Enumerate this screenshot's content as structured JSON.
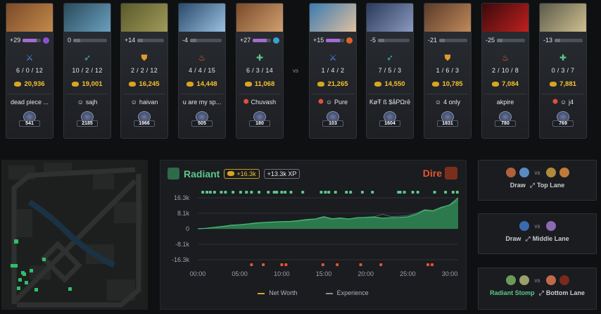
{
  "players": [
    {
      "team": "radiant",
      "net_change": "+29",
      "level_fill": 0.75,
      "facet_color": "#8b4fd0",
      "role_icon": "sword-icon",
      "role_color": "#5a8bf0",
      "kda": "6 / 0 / 12",
      "net_worth": "20,936",
      "name": "dead piece ...",
      "status": "",
      "medal": "541",
      "portrait_colors": [
        "#7a4a2a",
        "#c48a4a"
      ]
    },
    {
      "team": "radiant",
      "net_change": "0",
      "level_fill": 0.0,
      "facet_color": "",
      "role_icon": "bow-icon",
      "role_color": "#38b7b0",
      "kda": "10 / 2 / 12",
      "net_worth": "19,001",
      "name": "sajh",
      "status": "smile",
      "medal": "2185",
      "portrait_colors": [
        "#2a4a5a",
        "#6aa0c0"
      ]
    },
    {
      "team": "radiant",
      "net_change": "+14",
      "level_fill": 0.0,
      "facet_color": "",
      "role_icon": "shield-icon",
      "role_color": "#e09a2a",
      "kda": "2 / 2 / 12",
      "net_worth": "16,245",
      "name": "haivan",
      "status": "smile",
      "medal": "1966",
      "portrait_colors": [
        "#5a5a2a",
        "#a09a5a"
      ]
    },
    {
      "team": "radiant",
      "net_change": "-4",
      "level_fill": 0.0,
      "facet_color": "",
      "role_icon": "fire-icon",
      "role_color": "#e06a3a",
      "kda": "4 / 4 / 15",
      "net_worth": "14,448",
      "name": "u are my sp...",
      "status": "",
      "medal": "505",
      "portrait_colors": [
        "#2a4a6a",
        "#9ac0e0"
      ]
    },
    {
      "team": "radiant",
      "net_change": "+27",
      "level_fill": 0.75,
      "facet_color": "#3aa0d0",
      "role_icon": "support-icon",
      "role_color": "#5cc88b",
      "kda": "6 / 3 / 14",
      "net_worth": "11,068",
      "name": "Chuvash",
      "status": "shield",
      "medal": "180",
      "portrait_colors": [
        "#7a4a2a",
        "#d0a070"
      ]
    },
    {
      "team": "dire",
      "net_change": "+15",
      "level_fill": 0.75,
      "facet_color": "#e0602a",
      "role_icon": "sword-icon",
      "role_color": "#5a8bf0",
      "kda": "1 / 4 / 2",
      "net_worth": "21,265",
      "name": "Pure",
      "status": "shield-smile",
      "medal": "103",
      "portrait_colors": [
        "#3a7ab0",
        "#e0c0a0"
      ]
    },
    {
      "team": "dire",
      "net_change": "-5",
      "level_fill": 0.0,
      "facet_color": "",
      "role_icon": "bow-icon",
      "role_color": "#38b7b0",
      "kda": "7 / 5 / 3",
      "net_worth": "14,550",
      "name": "ƘøŦ ß $åPΩrē",
      "status": "",
      "medal": "1604",
      "portrait_colors": [
        "#2a3a5a",
        "#8a9ac0"
      ]
    },
    {
      "team": "dire",
      "net_change": "-21",
      "level_fill": 0.0,
      "facet_color": "",
      "role_icon": "shield-icon",
      "role_color": "#e09a2a",
      "kda": "1 / 6 / 3",
      "net_worth": "10,785",
      "name": "4 only",
      "status": "smile",
      "medal": "1831",
      "portrait_colors": [
        "#5a3a2a",
        "#c08a5a"
      ]
    },
    {
      "team": "dire",
      "net_change": "-25",
      "level_fill": 0.0,
      "facet_color": "",
      "role_icon": "fire-icon",
      "role_color": "#e06a3a",
      "kda": "2 / 10 / 8",
      "net_worth": "7,084",
      "name": "akpire",
      "status": "",
      "medal": "780",
      "portrait_colors": [
        "#3a0a0a",
        "#c02020"
      ]
    },
    {
      "team": "dire",
      "net_change": "-13",
      "level_fill": 0.0,
      "facet_color": "",
      "role_icon": "support-icon",
      "role_color": "#5cc88b",
      "kda": "0 / 3 / 7",
      "net_worth": "7,881",
      "name": "j4",
      "status": "shield-smile",
      "medal": "769",
      "portrait_colors": [
        "#5a5a4a",
        "#d0c090"
      ]
    }
  ],
  "vs_label": "vs",
  "graph": {
    "radiant_label": "Radiant",
    "dire_label": "Dire",
    "gold_adv": "+16.3k",
    "xp_adv": "+13.3k XP",
    "legend_networth": "Net Worth",
    "legend_experience": "Experience",
    "colors": {
      "radiant": "#5cc88b",
      "dire": "#e8532f",
      "area": "#2f8a55"
    }
  },
  "chart_data": {
    "type": "area",
    "x_ticks": [
      "00:00",
      "05:00",
      "10:00",
      "15:00",
      "20:00",
      "25:00",
      "30:00"
    ],
    "y_ticks": [
      "16.3k",
      "8.1k",
      "0",
      "-8.1k",
      "-16.3k"
    ],
    "ylim": [
      -16300,
      16300
    ],
    "xlim": [
      0,
      31
    ],
    "series": [
      {
        "name": "Net Worth",
        "x": [
          0,
          1,
          2,
          3,
          4,
          5,
          6,
          7,
          8,
          9,
          10,
          11,
          12,
          13,
          14,
          15,
          16,
          17,
          18,
          19,
          20,
          21,
          22,
          23,
          24,
          25,
          26,
          27,
          28,
          29,
          30,
          31
        ],
        "values": [
          0,
          300,
          800,
          1300,
          1900,
          2200,
          2600,
          3100,
          3400,
          3600,
          3800,
          3900,
          4300,
          4900,
          5200,
          6400,
          5300,
          5700,
          5100,
          5900,
          6000,
          6200,
          5600,
          5900,
          6000,
          6300,
          7600,
          9800,
          9300,
          11200,
          12600,
          16300
        ]
      },
      {
        "name": "Experience",
        "x": [
          0,
          1,
          2,
          3,
          4,
          5,
          6,
          7,
          8,
          9,
          10,
          11,
          12,
          13,
          14,
          15,
          16,
          17,
          18,
          19,
          20,
          21,
          22,
          23,
          24,
          25,
          26,
          27,
          28,
          29,
          30,
          31
        ],
        "values": [
          0,
          200,
          700,
          1200,
          1700,
          2100,
          2500,
          2900,
          3300,
          3500,
          3700,
          3800,
          4100,
          4600,
          5000,
          6100,
          5100,
          5500,
          5300,
          5800,
          6100,
          6400,
          7700,
          6500,
          6600,
          7000,
          8200,
          10100,
          9800,
          11500,
          12400,
          14800
        ]
      }
    ],
    "radiant_events_x": [
      0.6,
      1.1,
      1.5,
      2.0,
      2.8,
      3.3,
      4.2,
      5.1,
      5.8,
      6.4,
      7.3,
      8.4,
      9.1,
      9.4,
      10.0,
      10.4,
      11.1,
      12.5,
      14.7,
      15.2,
      15.6,
      16.4,
      17.7,
      18.2,
      19.6,
      20.8,
      23.9,
      24.1,
      24.6,
      25.6,
      26.2,
      28.2,
      29.5,
      30.4,
      30.9
    ],
    "dire_events_x": [
      6.4,
      7.8,
      10.0,
      10.5,
      14.9,
      16.6,
      19.4,
      21.8,
      27.4,
      27.9
    ]
  },
  "lanes": [
    {
      "result": "Draw",
      "result_color": "#c9cdd2",
      "lane": "Top Lane",
      "lane_icon": "lane-icon",
      "left_colors": [
        "#b0603a",
        "#5a8ac0"
      ],
      "right_colors": [
        "#b08a3a",
        "#c07a3a"
      ]
    },
    {
      "result": "Draw",
      "result_color": "#c9cdd2",
      "lane": "Middle Lane",
      "lane_icon": "lane-icon",
      "left_colors": [
        "#3a6ab0"
      ],
      "right_colors": [
        "#8a6ab0"
      ]
    },
    {
      "result": "Radiant Stomp",
      "result_color": "#5cc88b",
      "lane": "Bottom Lane",
      "lane_icon": "lane-icon",
      "left_colors": [
        "#6a9a5a",
        "#9aa06a"
      ],
      "right_colors": [
        "#c06a4a",
        "#7a2a1a"
      ]
    }
  ]
}
